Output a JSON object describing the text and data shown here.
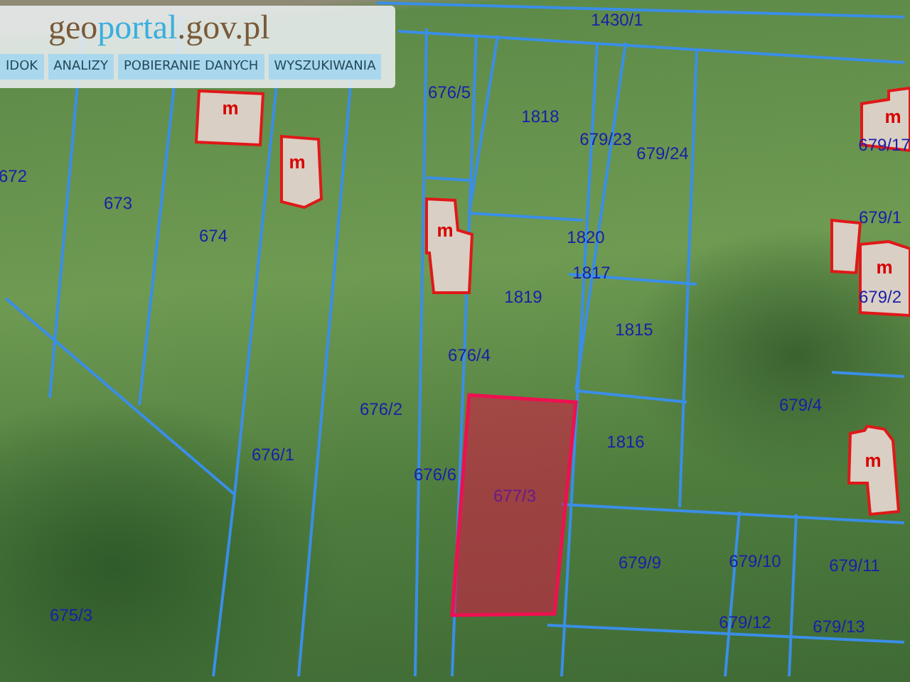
{
  "header": {
    "logo_parts": [
      "geo",
      "portal",
      ".gov.pl"
    ],
    "menu": [
      {
        "label": "IDOK"
      },
      {
        "label": "ANALIZY"
      },
      {
        "label": "POBIERANIE DANYCH"
      },
      {
        "label": "WYSZUKIWANIA"
      }
    ]
  },
  "map": {
    "parcels": [
      {
        "label": "1430/1",
        "selected": false
      },
      {
        "label": "676/5",
        "selected": false
      },
      {
        "label": "1818",
        "selected": false
      },
      {
        "label": "679/23",
        "selected": false
      },
      {
        "label": "679/24",
        "selected": false
      },
      {
        "label": "679/17",
        "selected": false
      },
      {
        "label": "679/1",
        "selected": false
      },
      {
        "label": "1820",
        "selected": false
      },
      {
        "label": "1817",
        "selected": false
      },
      {
        "label": "1819",
        "selected": false
      },
      {
        "label": "1815",
        "selected": false
      },
      {
        "label": "679/2",
        "selected": false
      },
      {
        "label": "672",
        "selected": false
      },
      {
        "label": "673",
        "selected": false
      },
      {
        "label": "674",
        "selected": false
      },
      {
        "label": "676/4",
        "selected": false
      },
      {
        "label": "676/2",
        "selected": false
      },
      {
        "label": "676/1",
        "selected": false
      },
      {
        "label": "1816",
        "selected": false
      },
      {
        "label": "679/4",
        "selected": false
      },
      {
        "label": "676/6",
        "selected": false
      },
      {
        "label": "677/3",
        "selected": true
      },
      {
        "label": "675/3",
        "selected": false
      },
      {
        "label": "679/9",
        "selected": false
      },
      {
        "label": "679/10",
        "selected": false
      },
      {
        "label": "679/11",
        "selected": false
      },
      {
        "label": "679/12",
        "selected": false
      },
      {
        "label": "679/13",
        "selected": false
      }
    ],
    "buildings": [
      {
        "label": "m"
      },
      {
        "label": "m"
      },
      {
        "label": "m"
      },
      {
        "label": "m"
      },
      {
        "label": "m"
      },
      {
        "label": "m"
      }
    ]
  }
}
